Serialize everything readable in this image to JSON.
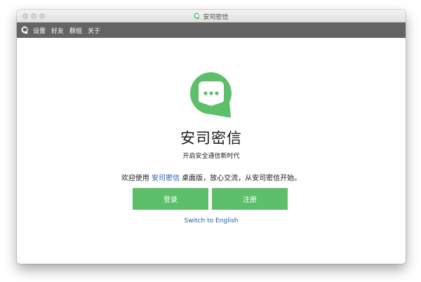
{
  "window": {
    "title": "安司密信"
  },
  "menu": {
    "items": [
      "设置",
      "好友",
      "群组",
      "关于"
    ]
  },
  "main": {
    "app_name": "安司密信",
    "tagline": "开启安全通信新时代",
    "welcome_prefix": "欢迎使用 ",
    "welcome_brand": "安司密信",
    "welcome_suffix": " 桌面版，放心交流，从安司密信开始。",
    "login_label": "登录",
    "register_label": "注册",
    "language_link": "Switch to English"
  },
  "colors": {
    "brand_green": "#5dbf69",
    "link_blue": "#1f5fa8",
    "menubar_gray": "#646464"
  },
  "icons": {
    "app": "chat-bubble-icon",
    "menu_logo": "chat-bubble-icon"
  }
}
